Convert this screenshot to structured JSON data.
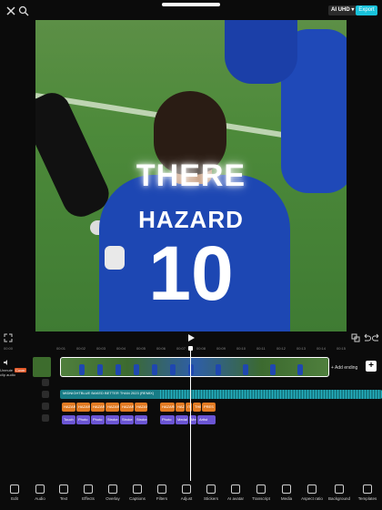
{
  "topbar": {
    "quality": "AI UHD ▾",
    "export": "Export"
  },
  "preview": {
    "caption": "THERE",
    "jersey_name": "HAZARD",
    "jersey_number": "10"
  },
  "ruler": {
    "ticks": [
      "00:00",
      "00:01",
      "00:02",
      "00:03",
      "00:04",
      "00:05",
      "00:06",
      "00:07",
      "00:08",
      "00:09",
      "00:10",
      "00:11",
      "00:12",
      "00:13",
      "00:14",
      "00:15"
    ]
  },
  "timeline": {
    "left_labels": [
      "Unmute clip audio",
      "Cover"
    ],
    "add_ending": "+ Add ending",
    "add_button": "+",
    "audio_label": "MIDNIGHTBLUE BAKED BETTER THAN 2023 (REMIX)",
    "orange_clips": [
      "HAZARD",
      "HAZARD",
      "HAZARD",
      "HAZARD",
      "HAZARD",
      "HAZARD",
      "HAZARD",
      "HAZ",
      "IT",
      "THE",
      "PRES"
    ],
    "purple_clips": [
      "Touch",
      "Photo",
      "Photo",
      "Stroke",
      "Stroke",
      "Stroke",
      "Photo",
      "Medal",
      "Me",
      "Artist"
    ]
  },
  "toolbar": {
    "items": [
      "Edit",
      "Audio",
      "Text",
      "Effects",
      "Overlay",
      "Captions",
      "Filters",
      "Adjust",
      "Stickers",
      "AI avatar",
      "Transcript",
      "Media",
      "Aspect ratio",
      "Background",
      "Templates"
    ]
  }
}
